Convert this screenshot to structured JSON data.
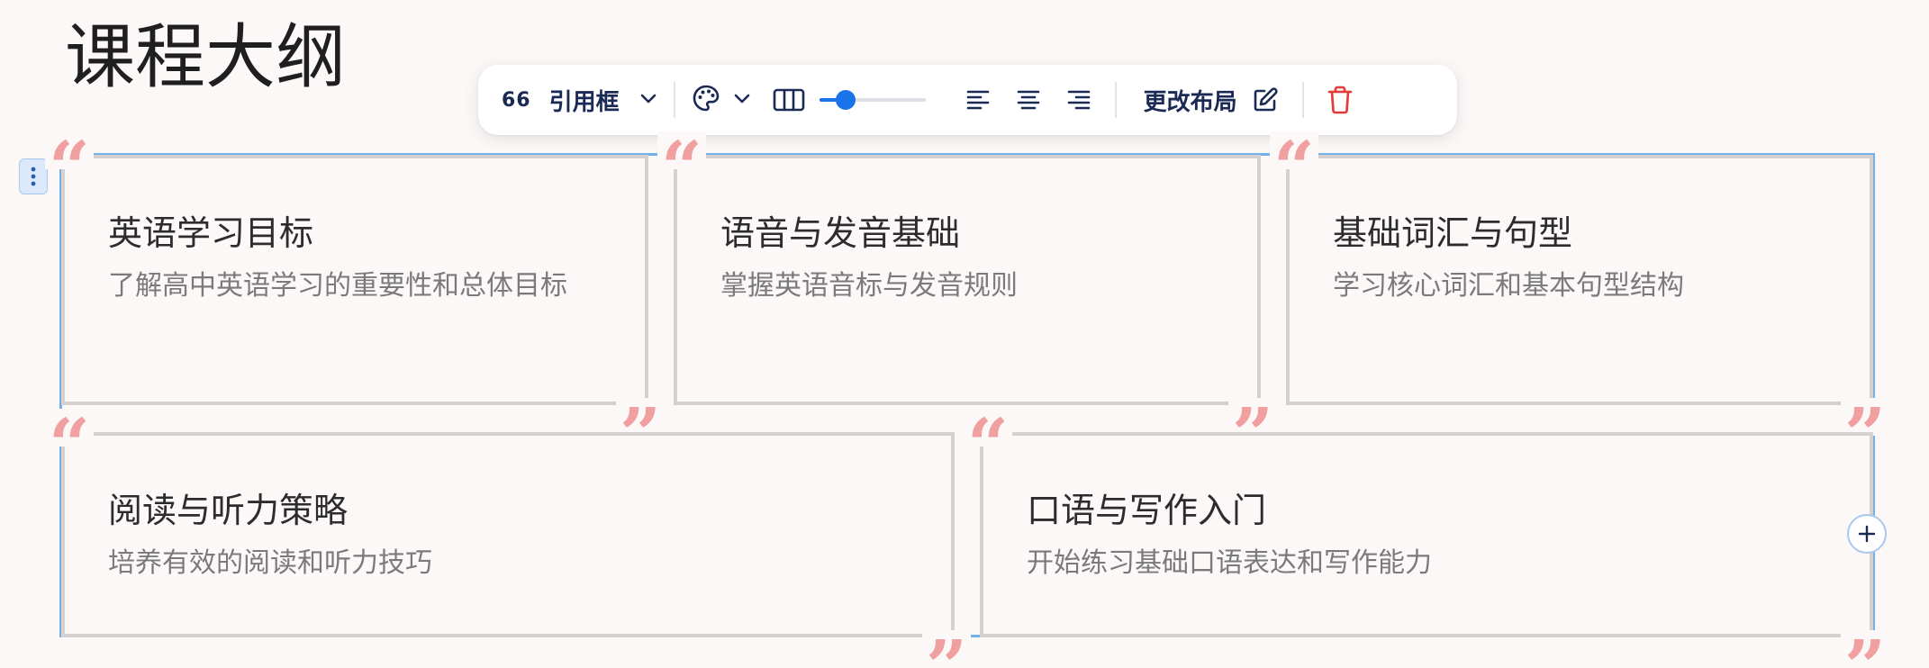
{
  "page": {
    "title": "课程大纲"
  },
  "toolbar": {
    "quote_icon_text": "66",
    "block_type_label": "引用框",
    "change_layout_label": "更改布局",
    "width_slider_value": 0.25,
    "colors": {
      "text": "#1b2a55",
      "accent": "#1a73e8",
      "delete": "#e53935"
    }
  },
  "cards": [
    {
      "title": "英语学习目标",
      "desc": "了解高中英语学习的重要性和总体目标"
    },
    {
      "title": "语音与发音基础",
      "desc": "掌握英语音标与发音规则"
    },
    {
      "title": "基础词汇与句型",
      "desc": "学习核心词汇和基本句型结构"
    },
    {
      "title": "阅读与听力策略",
      "desc": "培养有效的阅读和听力技巧"
    },
    {
      "title": "口语与写作入门",
      "desc": "开始练习基础口语表达和写作能力"
    }
  ],
  "quote_marks": {
    "open": "“",
    "close": "”",
    "color": "#f0a0a0"
  },
  "selection_color": "#73b0ea"
}
